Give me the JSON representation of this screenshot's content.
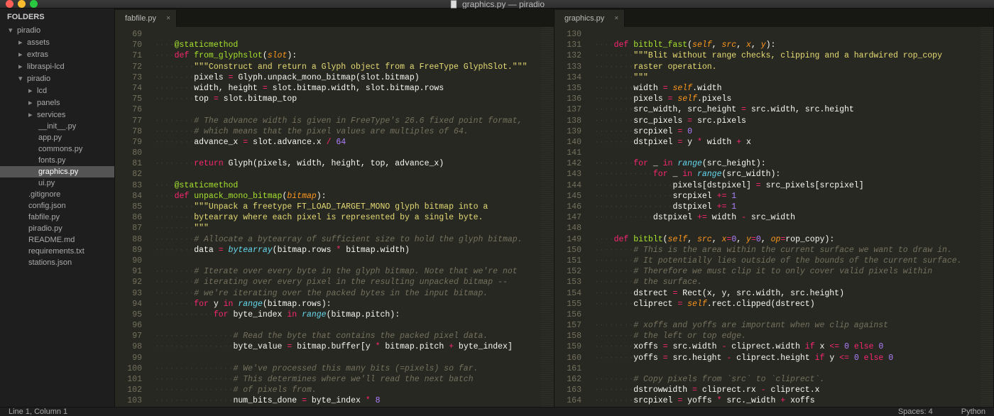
{
  "window_title": "graphics.py — piradio",
  "sidebar": {
    "header": "FOLDERS",
    "tree": [
      {
        "label": "piradio",
        "depth": 1,
        "arrow": "down"
      },
      {
        "label": "assets",
        "depth": 2,
        "arrow": "right",
        "bullet": true
      },
      {
        "label": "extras",
        "depth": 2,
        "arrow": "right",
        "bullet": true
      },
      {
        "label": "libraspi-lcd",
        "depth": 2,
        "arrow": "right",
        "bullet": true
      },
      {
        "label": "piradio",
        "depth": 2,
        "arrow": "down"
      },
      {
        "label": "lcd",
        "depth": 3,
        "arrow": "right",
        "bullet": true
      },
      {
        "label": "panels",
        "depth": 3,
        "arrow": "right",
        "bullet": true
      },
      {
        "label": "services",
        "depth": 3,
        "arrow": "right",
        "bullet": true
      },
      {
        "label": "__init__.py",
        "depth": 4
      },
      {
        "label": "app.py",
        "depth": 4
      },
      {
        "label": "commons.py",
        "depth": 4
      },
      {
        "label": "fonts.py",
        "depth": 4
      },
      {
        "label": "graphics.py",
        "depth": 4,
        "selected": true
      },
      {
        "label": "ui.py",
        "depth": 4
      },
      {
        "label": ".gitignore",
        "depth": 3
      },
      {
        "label": "config.json",
        "depth": 3
      },
      {
        "label": "fabfile.py",
        "depth": 3
      },
      {
        "label": "piradio.py",
        "depth": 3
      },
      {
        "label": "README.md",
        "depth": 3
      },
      {
        "label": "requirements.txt",
        "depth": 3
      },
      {
        "label": "stations.json",
        "depth": 3
      }
    ]
  },
  "left_tab": "fabfile.py",
  "right_tab": "graphics.py",
  "status": {
    "left": "Line 1, Column 1",
    "spaces": "Spaces: 4",
    "lang": "Python"
  },
  "left_lines": [
    {
      "n": 69,
      "tokens": []
    },
    {
      "n": 70,
      "indent": 1,
      "tokens": [
        [
          "dec",
          "@staticmethod"
        ]
      ]
    },
    {
      "n": 71,
      "indent": 1,
      "tokens": [
        [
          "kw",
          "def "
        ],
        [
          "dec",
          "from_glyphslot"
        ],
        [
          "",
          "("
        ],
        [
          "par",
          "slot"
        ],
        [
          "",
          "): "
        ]
      ]
    },
    {
      "n": 72,
      "indent": 2,
      "tokens": [
        [
          "str",
          "\"\"\"Construct and return a Glyph object from a FreeType GlyphSlot.\"\"\""
        ]
      ]
    },
    {
      "n": 73,
      "indent": 2,
      "tokens": [
        [
          "",
          "pixels "
        ],
        [
          "op",
          "="
        ],
        [
          "",
          " Glyph.unpack_mono_bitmap(slot.bitmap)"
        ]
      ]
    },
    {
      "n": 74,
      "indent": 2,
      "tokens": [
        [
          "",
          "width, height "
        ],
        [
          "op",
          "="
        ],
        [
          "",
          " slot.bitmap.width, slot.bitmap.rows"
        ]
      ]
    },
    {
      "n": 75,
      "indent": 2,
      "tokens": [
        [
          "",
          "top "
        ],
        [
          "op",
          "="
        ],
        [
          "",
          " slot.bitmap_top"
        ]
      ]
    },
    {
      "n": 76,
      "tokens": []
    },
    {
      "n": 77,
      "indent": 2,
      "tokens": [
        [
          "cm",
          "# The advance width is given in FreeType's 26.6 fixed point format,"
        ]
      ]
    },
    {
      "n": 78,
      "indent": 2,
      "tokens": [
        [
          "cm",
          "# which means that the pixel values are multiples of 64."
        ]
      ]
    },
    {
      "n": 79,
      "indent": 2,
      "tokens": [
        [
          "",
          "advance_x "
        ],
        [
          "op",
          "="
        ],
        [
          "",
          " slot.advance.x "
        ],
        [
          "op",
          "/"
        ],
        [
          "",
          " "
        ],
        [
          "num",
          "64"
        ]
      ]
    },
    {
      "n": 80,
      "tokens": []
    },
    {
      "n": 81,
      "indent": 2,
      "tokens": [
        [
          "kw",
          "return "
        ],
        [
          "",
          "Glyph(pixels, width, height, top, advance_x)"
        ]
      ]
    },
    {
      "n": 82,
      "tokens": []
    },
    {
      "n": 83,
      "indent": 1,
      "tokens": [
        [
          "dec",
          "@staticmethod"
        ]
      ]
    },
    {
      "n": 84,
      "indent": 1,
      "tokens": [
        [
          "kw",
          "def "
        ],
        [
          "dec",
          "unpack_mono_bitmap"
        ],
        [
          "",
          "("
        ],
        [
          "par",
          "bitmap"
        ],
        [
          "",
          "): "
        ]
      ]
    },
    {
      "n": 85,
      "indent": 2,
      "tokens": [
        [
          "str",
          "\"\"\"Unpack a freetype FT_LOAD_TARGET_MONO glyph bitmap into a"
        ]
      ]
    },
    {
      "n": 86,
      "indent": 2,
      "tokens": [
        [
          "str",
          "bytearray where each pixel is represented by a single byte."
        ]
      ]
    },
    {
      "n": 87,
      "indent": 2,
      "tokens": [
        [
          "str",
          "\"\"\""
        ]
      ]
    },
    {
      "n": 88,
      "indent": 2,
      "tokens": [
        [
          "cm",
          "# Allocate a bytearray of sufficient size to hold the glyph bitmap."
        ]
      ]
    },
    {
      "n": 89,
      "indent": 2,
      "tokens": [
        [
          "",
          "data "
        ],
        [
          "op",
          "="
        ],
        [
          "",
          " "
        ],
        [
          "cls",
          "bytearray"
        ],
        [
          "",
          "(bitmap.rows "
        ],
        [
          "op",
          "*"
        ],
        [
          "",
          " bitmap.width)"
        ]
      ]
    },
    {
      "n": 90,
      "tokens": []
    },
    {
      "n": 91,
      "indent": 2,
      "tokens": [
        [
          "cm",
          "# Iterate over every byte in the glyph bitmap. Note that we're not"
        ]
      ]
    },
    {
      "n": 92,
      "indent": 2,
      "tokens": [
        [
          "cm",
          "# iterating over every pixel in the resulting unpacked bitmap --"
        ]
      ]
    },
    {
      "n": 93,
      "indent": 2,
      "tokens": [
        [
          "cm",
          "# we're iterating over the packed bytes in the input bitmap."
        ]
      ]
    },
    {
      "n": 94,
      "indent": 2,
      "tokens": [
        [
          "kw",
          "for "
        ],
        [
          "",
          "y "
        ],
        [
          "kw",
          "in "
        ],
        [
          "cls",
          "range"
        ],
        [
          "",
          "(bitmap.rows):"
        ]
      ]
    },
    {
      "n": 95,
      "indent": 3,
      "tokens": [
        [
          "kw",
          "for "
        ],
        [
          "",
          "byte_index "
        ],
        [
          "kw",
          "in "
        ],
        [
          "cls",
          "range"
        ],
        [
          "",
          "(bitmap.pitch):"
        ]
      ]
    },
    {
      "n": 96,
      "tokens": []
    },
    {
      "n": 97,
      "indent": 4,
      "tokens": [
        [
          "cm",
          "# Read the byte that contains the packed pixel data."
        ]
      ]
    },
    {
      "n": 98,
      "indent": 4,
      "tokens": [
        [
          "",
          "byte_value "
        ],
        [
          "op",
          "="
        ],
        [
          "",
          " bitmap.buffer[y "
        ],
        [
          "op",
          "*"
        ],
        [
          "",
          " bitmap.pitch "
        ],
        [
          "op",
          "+"
        ],
        [
          "",
          " byte_index]"
        ]
      ]
    },
    {
      "n": 99,
      "tokens": []
    },
    {
      "n": 100,
      "indent": 4,
      "tokens": [
        [
          "cm",
          "# We've processed this many bits (=pixels) so far."
        ]
      ]
    },
    {
      "n": 101,
      "indent": 4,
      "tokens": [
        [
          "cm",
          "# This determines where we'll read the next batch"
        ]
      ]
    },
    {
      "n": 102,
      "indent": 4,
      "tokens": [
        [
          "cm",
          "# of pixels from."
        ]
      ]
    },
    {
      "n": 103,
      "indent": 4,
      "tokens": [
        [
          "",
          "num_bits_done "
        ],
        [
          "op",
          "="
        ],
        [
          "",
          " byte_index "
        ],
        [
          "op",
          "*"
        ],
        [
          "",
          " "
        ],
        [
          "num",
          "8"
        ]
      ]
    }
  ],
  "right_lines": [
    {
      "n": 130,
      "tokens": []
    },
    {
      "n": 131,
      "indent": 1,
      "tokens": [
        [
          "kw",
          "def "
        ],
        [
          "dec",
          "bitblt_fast"
        ],
        [
          "",
          "("
        ],
        [
          "self",
          "self"
        ],
        [
          "",
          ", "
        ],
        [
          "par",
          "src"
        ],
        [
          "",
          ", "
        ],
        [
          "par",
          "x"
        ],
        [
          "",
          ", "
        ],
        [
          "par",
          "y"
        ],
        [
          "",
          "): "
        ]
      ]
    },
    {
      "n": 132,
      "indent": 2,
      "tokens": [
        [
          "str",
          "\"\"\"Blit without range checks, clipping and a hardwired rop_copy"
        ]
      ]
    },
    {
      "n": 133,
      "indent": 2,
      "tokens": [
        [
          "str",
          "raster operation."
        ]
      ]
    },
    {
      "n": 134,
      "indent": 2,
      "tokens": [
        [
          "str",
          "\"\"\""
        ]
      ]
    },
    {
      "n": 135,
      "indent": 2,
      "tokens": [
        [
          "",
          "width "
        ],
        [
          "op",
          "="
        ],
        [
          "",
          " "
        ],
        [
          "self",
          "self"
        ],
        [
          "",
          ".width"
        ]
      ]
    },
    {
      "n": 136,
      "indent": 2,
      "tokens": [
        [
          "",
          "pixels "
        ],
        [
          "op",
          "="
        ],
        [
          "",
          " "
        ],
        [
          "self",
          "self"
        ],
        [
          "",
          ".pixels"
        ]
      ]
    },
    {
      "n": 137,
      "indent": 2,
      "tokens": [
        [
          "",
          "src_width, src_height "
        ],
        [
          "op",
          "="
        ],
        [
          "",
          " src.width, src.height"
        ]
      ]
    },
    {
      "n": 138,
      "indent": 2,
      "tokens": [
        [
          "",
          "src_pixels "
        ],
        [
          "op",
          "="
        ],
        [
          "",
          " src.pixels"
        ]
      ]
    },
    {
      "n": 139,
      "indent": 2,
      "tokens": [
        [
          "",
          "srcpixel "
        ],
        [
          "op",
          "="
        ],
        [
          "",
          " "
        ],
        [
          "num",
          "0"
        ]
      ]
    },
    {
      "n": 140,
      "indent": 2,
      "tokens": [
        [
          "",
          "dstpixel "
        ],
        [
          "op",
          "="
        ],
        [
          "",
          " y "
        ],
        [
          "op",
          "*"
        ],
        [
          "",
          " width "
        ],
        [
          "op",
          "+"
        ],
        [
          "",
          " x"
        ]
      ]
    },
    {
      "n": 141,
      "tokens": []
    },
    {
      "n": 142,
      "indent": 2,
      "tokens": [
        [
          "kw",
          "for "
        ],
        [
          "",
          "_ "
        ],
        [
          "kw",
          "in "
        ],
        [
          "cls",
          "range"
        ],
        [
          "",
          "(src_height):"
        ]
      ]
    },
    {
      "n": 143,
      "indent": 3,
      "tokens": [
        [
          "kw",
          "for "
        ],
        [
          "",
          "_ "
        ],
        [
          "kw",
          "in "
        ],
        [
          "cls",
          "range"
        ],
        [
          "",
          "(src_width):"
        ]
      ]
    },
    {
      "n": 144,
      "indent": 4,
      "tokens": [
        [
          "",
          "pixels[dstpixel] "
        ],
        [
          "op",
          "="
        ],
        [
          "",
          " src_pixels[srcpixel]"
        ]
      ]
    },
    {
      "n": 145,
      "indent": 4,
      "tokens": [
        [
          "",
          "srcpixel "
        ],
        [
          "op",
          "+="
        ],
        [
          "",
          " "
        ],
        [
          "num",
          "1"
        ]
      ]
    },
    {
      "n": 146,
      "indent": 4,
      "tokens": [
        [
          "",
          "dstpixel "
        ],
        [
          "op",
          "+="
        ],
        [
          "",
          " "
        ],
        [
          "num",
          "1"
        ]
      ]
    },
    {
      "n": 147,
      "indent": 3,
      "tokens": [
        [
          "",
          "dstpixel "
        ],
        [
          "op",
          "+="
        ],
        [
          "",
          " width "
        ],
        [
          "op",
          "-"
        ],
        [
          "",
          " src_width"
        ]
      ]
    },
    {
      "n": 148,
      "tokens": []
    },
    {
      "n": 149,
      "indent": 1,
      "tokens": [
        [
          "kw",
          "def "
        ],
        [
          "dec",
          "bitblt"
        ],
        [
          "",
          "("
        ],
        [
          "self",
          "self"
        ],
        [
          "",
          ", "
        ],
        [
          "par",
          "src"
        ],
        [
          "",
          ", "
        ],
        [
          "par",
          "x"
        ],
        [
          "op",
          "="
        ],
        [
          "num",
          "0"
        ],
        [
          "",
          ", "
        ],
        [
          "par",
          "y"
        ],
        [
          "op",
          "="
        ],
        [
          "num",
          "0"
        ],
        [
          "",
          ", "
        ],
        [
          "par",
          "op"
        ],
        [
          "op",
          "="
        ],
        [
          "",
          "rop_copy): "
        ]
      ]
    },
    {
      "n": 150,
      "indent": 2,
      "tokens": [
        [
          "cm",
          "# This is the area within the current surface we want to draw in."
        ]
      ]
    },
    {
      "n": 151,
      "indent": 2,
      "tokens": [
        [
          "cm",
          "# It potentially lies outside of the bounds of the current surface."
        ]
      ]
    },
    {
      "n": 152,
      "indent": 2,
      "tokens": [
        [
          "cm",
          "# Therefore we must clip it to only cover valid pixels within"
        ]
      ]
    },
    {
      "n": 153,
      "indent": 2,
      "tokens": [
        [
          "cm",
          "# the surface."
        ]
      ]
    },
    {
      "n": 154,
      "indent": 2,
      "tokens": [
        [
          "",
          "dstrect "
        ],
        [
          "op",
          "="
        ],
        [
          "",
          " Rect(x, y, src.width, src.height)"
        ]
      ]
    },
    {
      "n": 155,
      "indent": 2,
      "tokens": [
        [
          "",
          "cliprect "
        ],
        [
          "op",
          "="
        ],
        [
          "",
          " "
        ],
        [
          "self",
          "self"
        ],
        [
          "",
          ".rect.clipped(dstrect)"
        ]
      ]
    },
    {
      "n": 156,
      "tokens": []
    },
    {
      "n": 157,
      "indent": 2,
      "tokens": [
        [
          "cm",
          "# xoffs and yoffs are important when we clip against"
        ]
      ]
    },
    {
      "n": 158,
      "indent": 2,
      "tokens": [
        [
          "cm",
          "# the left or top edge."
        ]
      ]
    },
    {
      "n": 159,
      "indent": 2,
      "tokens": [
        [
          "",
          "xoffs "
        ],
        [
          "op",
          "="
        ],
        [
          "",
          " src.width "
        ],
        [
          "op",
          "-"
        ],
        [
          "",
          " cliprect.width "
        ],
        [
          "kw",
          "if"
        ],
        [
          "",
          " x "
        ],
        [
          "op",
          "<="
        ],
        [
          "",
          " "
        ],
        [
          "num",
          "0"
        ],
        [
          "",
          " "
        ],
        [
          "kw",
          "else"
        ],
        [
          "",
          " "
        ],
        [
          "num",
          "0"
        ]
      ]
    },
    {
      "n": 160,
      "indent": 2,
      "tokens": [
        [
          "",
          "yoffs "
        ],
        [
          "op",
          "="
        ],
        [
          "",
          " src.height "
        ],
        [
          "op",
          "-"
        ],
        [
          "",
          " cliprect.height "
        ],
        [
          "kw",
          "if"
        ],
        [
          "",
          " y "
        ],
        [
          "op",
          "<="
        ],
        [
          "",
          " "
        ],
        [
          "num",
          "0"
        ],
        [
          "",
          " "
        ],
        [
          "kw",
          "else"
        ],
        [
          "",
          " "
        ],
        [
          "num",
          "0"
        ]
      ]
    },
    {
      "n": 161,
      "tokens": []
    },
    {
      "n": 162,
      "indent": 2,
      "tokens": [
        [
          "cm",
          "# Copy pixels from `src` to `cliprect`."
        ]
      ]
    },
    {
      "n": 163,
      "indent": 2,
      "tokens": [
        [
          "",
          "dstrowwidth "
        ],
        [
          "op",
          "="
        ],
        [
          "",
          " cliprect.rx "
        ],
        [
          "op",
          "-"
        ],
        [
          "",
          " cliprect.x"
        ]
      ]
    },
    {
      "n": 164,
      "indent": 2,
      "tokens": [
        [
          "",
          "srcpixel "
        ],
        [
          "op",
          "="
        ],
        [
          "",
          " yoffs "
        ],
        [
          "op",
          "*"
        ],
        [
          "",
          " src._width "
        ],
        [
          "op",
          "+"
        ],
        [
          "",
          " xoffs"
        ]
      ]
    }
  ]
}
